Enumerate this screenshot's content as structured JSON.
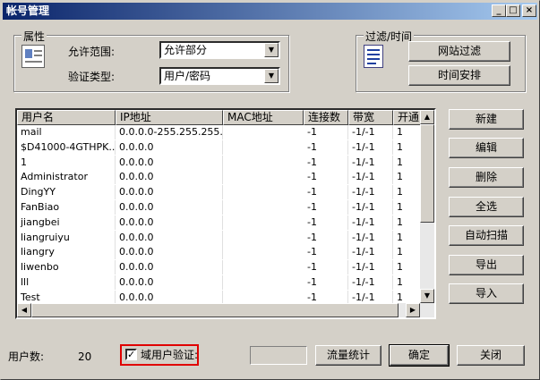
{
  "window": {
    "title": "帐号管理",
    "controls": [
      "_",
      "□",
      "×"
    ]
  },
  "attributes": {
    "label": "属性",
    "scope_label": "允许范围:",
    "scope_value": "允许部分",
    "auth_label": "验证类型:",
    "auth_value": "用户/密码"
  },
  "filter": {
    "label": "过滤/时间",
    "site_filter": "网站过滤",
    "schedule": "时间安排"
  },
  "table": {
    "columns": [
      "用户名",
      "IP地址",
      "MAC地址",
      "连接数",
      "带宽",
      "开通"
    ],
    "rows": [
      [
        "mail",
        "0.0.0.0-255.255.255....",
        "",
        "-1",
        "-1/-1",
        "1"
      ],
      [
        "$D41000-4GTHPK...",
        "0.0.0.0",
        "",
        "-1",
        "-1/-1",
        "1"
      ],
      [
        "1",
        "0.0.0.0",
        "",
        "-1",
        "-1/-1",
        "1"
      ],
      [
        "Administrator",
        "0.0.0.0",
        "",
        "-1",
        "-1/-1",
        "1"
      ],
      [
        "DingYY",
        "0.0.0.0",
        "",
        "-1",
        "-1/-1",
        "1"
      ],
      [
        "FanBiao",
        "0.0.0.0",
        "",
        "-1",
        "-1/-1",
        "1"
      ],
      [
        "jiangbei",
        "0.0.0.0",
        "",
        "-1",
        "-1/-1",
        "1"
      ],
      [
        "liangruiyu",
        "0.0.0.0",
        "",
        "-1",
        "-1/-1",
        "1"
      ],
      [
        "liangry",
        "0.0.0.0",
        "",
        "-1",
        "-1/-1",
        "1"
      ],
      [
        "liwenbo",
        "0.0.0.0",
        "",
        "-1",
        "-1/-1",
        "1"
      ],
      [
        "lll",
        "0.0.0.0",
        "",
        "-1",
        "-1/-1",
        "1"
      ],
      [
        "Test",
        "0.0.0.0",
        "",
        "-1",
        "-1/-1",
        "1"
      ]
    ]
  },
  "side_buttons": {
    "new": "新建",
    "edit": "编辑",
    "delete": "删除",
    "select_all": "全选",
    "auto_scan": "自动扫描",
    "export": "导出",
    "import": "导入"
  },
  "footer": {
    "user_count_label": "用户数:",
    "user_count": "20",
    "domain_auth_label": "域用户验证:",
    "domain_auth_checked": true,
    "traffic_stats": "流量统计",
    "ok": "确定",
    "close": "关闭"
  }
}
